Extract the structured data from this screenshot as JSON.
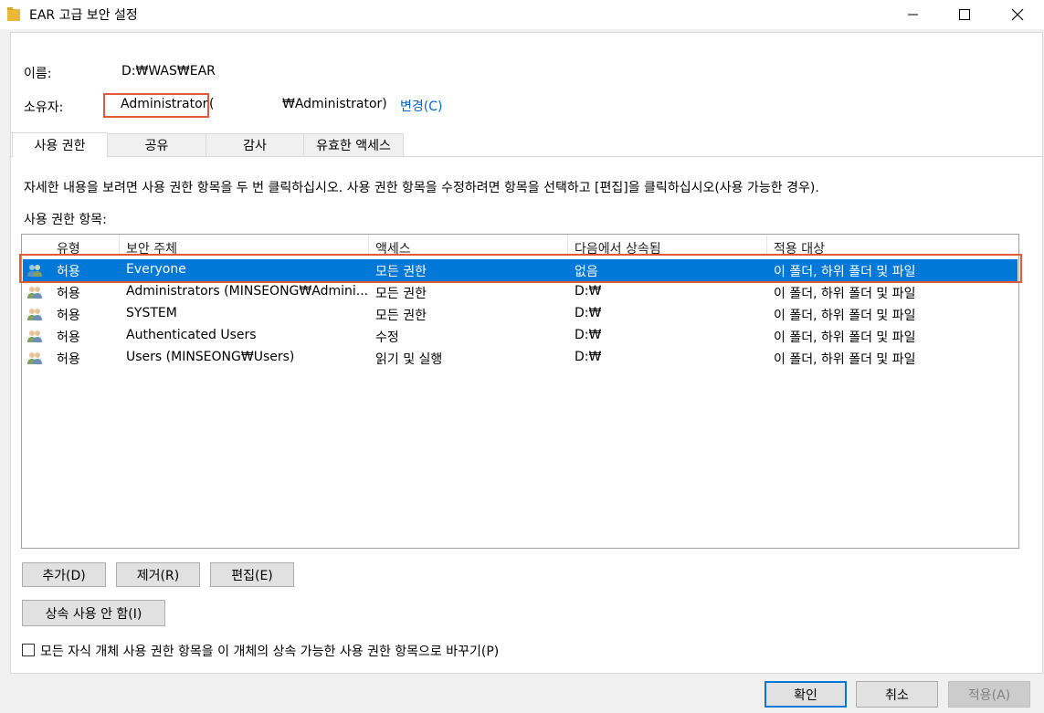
{
  "window": {
    "title": "EAR 고급 보안 설정"
  },
  "info": {
    "name_label": "이름:",
    "name_value": "D:₩WAS₩EAR",
    "owner_label": "소유자:",
    "owner_value": "Administrator",
    "owner_paren_open": "(",
    "owner_full": "₩Administrator)",
    "change_link": "변경(C)"
  },
  "tabs": [
    {
      "label": "사용 권한"
    },
    {
      "label": "공유"
    },
    {
      "label": "감사"
    },
    {
      "label": "유효한 액세스"
    }
  ],
  "description": "자세한 내용을 보려면 사용 권한 항목을 두 번 클릭하십시오. 사용 권한 항목을 수정하려면 항목을 선택하고 [편집]을 클릭하십시오(사용 가능한 경우).",
  "entries_label": "사용 권한 항목:",
  "table": {
    "columns": [
      "유형",
      "보안 주체",
      "액세스",
      "다음에서 상속됨",
      "적용 대상"
    ],
    "rows": [
      {
        "type": "허용",
        "principal": "Everyone",
        "access": "모든 권한",
        "inherited": "없음",
        "applies": "이 폴더, 하위 폴더 및 파일"
      },
      {
        "type": "허용",
        "principal": "Administrators (MINSEONG₩Admini...",
        "access": "모든 권한",
        "inherited": "D:₩",
        "applies": "이 폴더, 하위 폴더 및 파일"
      },
      {
        "type": "허용",
        "principal": "SYSTEM",
        "access": "모든 권한",
        "inherited": "D:₩",
        "applies": "이 폴더, 하위 폴더 및 파일"
      },
      {
        "type": "허용",
        "principal": "Authenticated Users",
        "access": "수정",
        "inherited": "D:₩",
        "applies": "이 폴더, 하위 폴더 및 파일"
      },
      {
        "type": "허용",
        "principal": "Users (MINSEONG₩Users)",
        "access": "읽기 및 실행",
        "inherited": "D:₩",
        "applies": "이 폴더, 하위 폴더 및 파일"
      }
    ],
    "selected_index": 0
  },
  "buttons": {
    "add": "추가(D)",
    "remove": "제거(R)",
    "edit": "편집(E)",
    "disable_inheritance": "상속 사용 안 함(I)",
    "replace_checkbox": "모든 자식 개체 사용 권한 항목을 이 개체의 상속 가능한 사용 권한 항목으로 바꾸기(P)",
    "ok": "확인",
    "cancel": "취소",
    "apply": "적용(A)"
  },
  "colors": {
    "selection": "#0078d7",
    "highlight_box": "#e05a39",
    "link": "#0066cc"
  }
}
